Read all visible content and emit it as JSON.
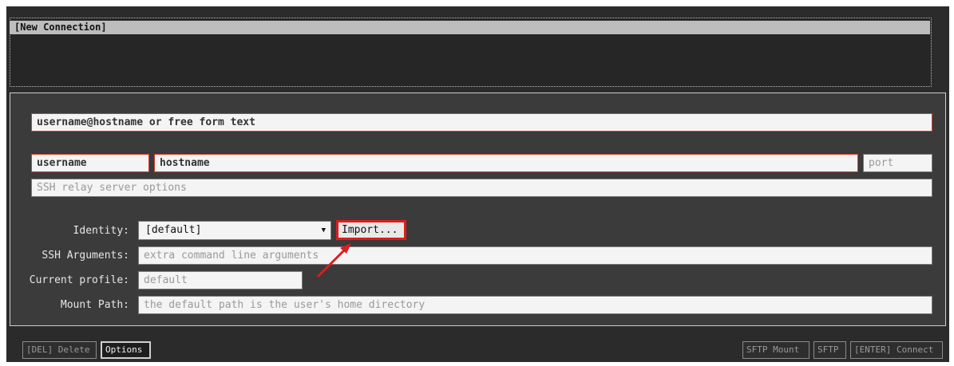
{
  "connection_list": {
    "items": [
      {
        "label": "[New Connection]"
      }
    ]
  },
  "form": {
    "free_form": {
      "placeholder": "username@hostname or free form text"
    },
    "username": {
      "placeholder": "username"
    },
    "hostname": {
      "placeholder": "hostname"
    },
    "port": {
      "placeholder": "port"
    },
    "relay": {
      "placeholder": "SSH relay server options"
    },
    "identity": {
      "label": "Identity:",
      "value": "[default]"
    },
    "import_button": "Import...",
    "ssh_args": {
      "label": "SSH Arguments:",
      "placeholder": "extra command line arguments"
    },
    "profile": {
      "label": "Current profile:",
      "placeholder": "default"
    },
    "mount_path": {
      "label": "Mount Path:",
      "placeholder": "the default path is the user's home directory"
    }
  },
  "bottom_bar": {
    "delete": "[DEL] Delete",
    "options": "Options",
    "sftp_mount": "SFTP Mount",
    "sftp": "SFTP",
    "connect": "[ENTER] Connect"
  },
  "colors": {
    "highlight_red": "#e21b1b",
    "field_red_border": "#d23c2a"
  }
}
